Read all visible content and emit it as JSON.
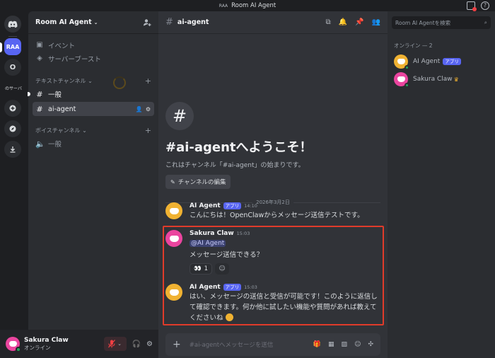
{
  "titlebar": {
    "abbr": "RAA",
    "title": "Room AI Agent"
  },
  "rail": {
    "raa": "RAA",
    "o": "O",
    "server3": "のサーバ"
  },
  "sidebar": {
    "guild_name": "Room AI Agent",
    "events": "イベント",
    "boosts": "サーバーブースト",
    "text_category": "テキストチャンネル",
    "channels": [
      {
        "name": "一般"
      },
      {
        "name": "ai-agent"
      }
    ],
    "voice_category": "ボイスチャンネル",
    "voice_channels": [
      {
        "name": "一般"
      }
    ]
  },
  "user": {
    "name": "Sakura Claw",
    "status": "オンライン"
  },
  "header": {
    "channel": "ai-agent"
  },
  "welcome": {
    "title": "#ai-agentへようこそ！",
    "subtitle": "これはチャンネル「#ai-agent」の始まりです。",
    "edit_button": "チャンネルの編集"
  },
  "date_divider": "2026年3月2日",
  "messages": [
    {
      "author": "AI Agent",
      "badge": "アプリ",
      "time": "14:10",
      "text": "こんにちは！OpenClawからメッセージ送信テストです。"
    },
    {
      "author": "Sakura Claw",
      "time": "15:03",
      "mention": "@AI Agent",
      "text": "メッセージ送信できる？",
      "reaction_emoji": "👀",
      "reaction_count": "1"
    },
    {
      "author": "AI Agent",
      "badge": "アプリ",
      "time": "15:03",
      "text": "はい、メッセージの送信と受信が可能です！このように返信して確認できます。何か他に試したい機能や質問があれば教えてくださいね"
    }
  ],
  "composer": {
    "placeholder": "#ai-agentへメッセージを送信"
  },
  "members": {
    "search_placeholder": "Room AI Agentを検索",
    "category": "オンライン — 2",
    "list": [
      {
        "name": "AI Agent",
        "badge": "アプリ"
      },
      {
        "name": "Sakura Claw"
      }
    ]
  },
  "colors": {
    "blurple": "#5865f2",
    "online": "#23a55a",
    "highlight": "#e03b2a"
  }
}
